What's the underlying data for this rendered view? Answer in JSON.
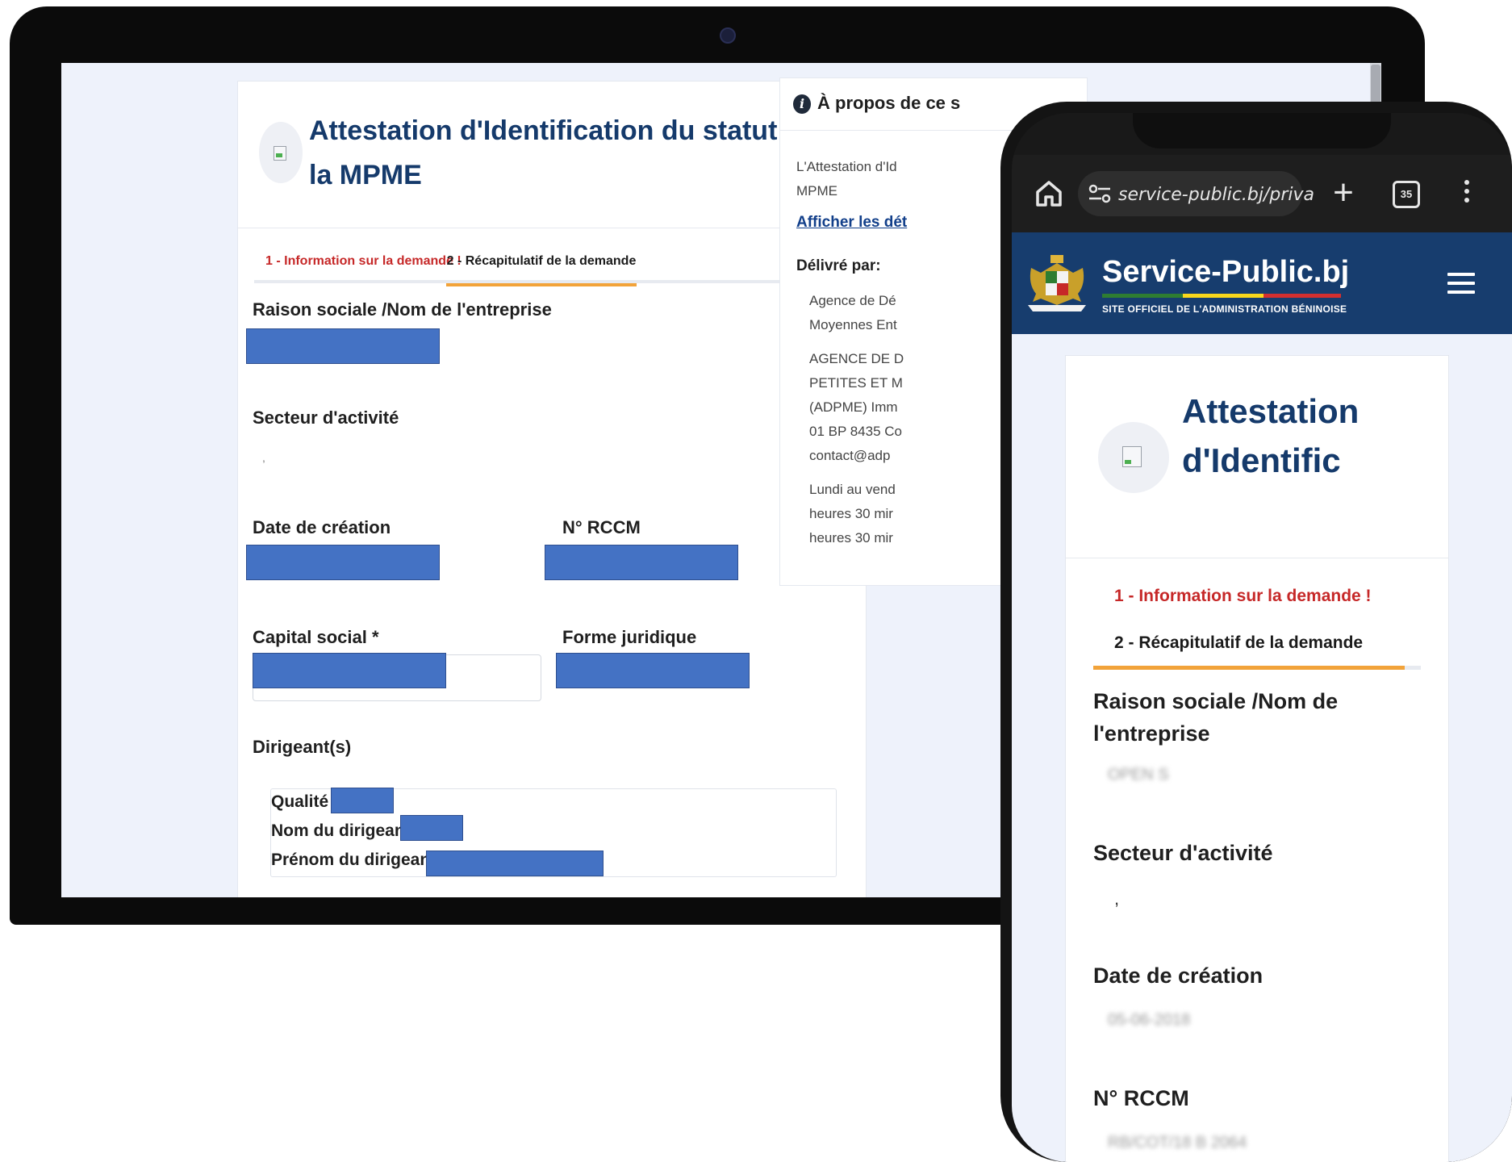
{
  "desktop": {
    "page_title": "Attestation d'Identification du statut de la MPME",
    "tabs": [
      {
        "label": "1 - Information sur la demande !"
      },
      {
        "label": "2 - Récapitulatif de la demande"
      }
    ],
    "fields": {
      "raison_sociale": "Raison sociale /Nom de l'entreprise",
      "secteur": "Secteur d'activité",
      "secteur_value": ",",
      "date_creation": "Date de création",
      "rccm": "N° RCCM",
      "capital": "Capital social *",
      "forme": "Forme juridique",
      "dirigeants": "Dirigeant(s)"
    },
    "dirigeant": {
      "qualite": "Qualité :",
      "nom": "Nom du dirigeant :",
      "prenom": "Prénom du dirigeant :"
    },
    "about": {
      "title": "À propos de ce s",
      "desc_line1": "L'Attestation d'Id",
      "desc_line2": "MPME",
      "details_link": "Afficher les dét",
      "delivered_by": "Délivré par:",
      "agency_line1": "Agence de Dé",
      "agency_line2": "Moyennes Ent",
      "address_lines": [
        "AGENCE DE D",
        "PETITES ET M",
        "(ADPME) Imm",
        "01 BP 8435 Co",
        "contact@adp"
      ],
      "hours_lines": [
        "Lundi au vend",
        "heures 30 mir",
        "heures 30 mir"
      ]
    }
  },
  "mobile": {
    "url": "service-public.bj/priva",
    "tab_count": "35",
    "site_title": "Service-Public.bj",
    "site_tagline": "SITE OFFICIEL DE L'ADMINISTRATION BÉNINOISE",
    "page_title": "Attestation d'Identific",
    "tabs": [
      {
        "label": "1 - Information sur la demande !"
      },
      {
        "label": "2 - Récapitulatif de la demande"
      }
    ],
    "fields": {
      "raison_sociale": "Raison sociale /Nom de l'entreprise",
      "raison_sociale_value": "OPEN S",
      "secteur": "Secteur d'activité",
      "secteur_value": ",",
      "date_creation": "Date de création",
      "date_creation_value": "05-06-2018",
      "rccm": "N° RCCM",
      "rccm_value": "RB/COT/18 B 2064"
    }
  },
  "colors": {
    "title_blue": "#153a6b",
    "active_tab_red": "#c62828",
    "tab_underline": "#f2a33a",
    "redaction_blue": "#4472c4",
    "header_blue": "#173d6e"
  }
}
